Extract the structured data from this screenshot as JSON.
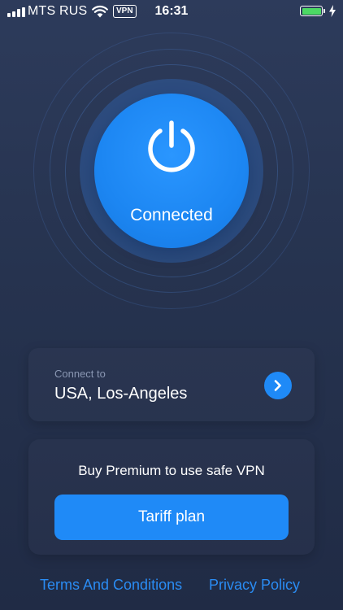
{
  "status_bar": {
    "carrier": "MTS RUS",
    "vpn_badge": "VPN",
    "time": "16:31",
    "battery_color": "#4cd964",
    "icons": [
      "signal-icon",
      "wifi-icon",
      "battery-icon",
      "charging-bolt-icon"
    ]
  },
  "power": {
    "status": "Connected",
    "icon": "power-icon",
    "accent_color": "#1f8af7"
  },
  "connect": {
    "caption": "Connect to",
    "location": "USA, Los-Angeles",
    "icon": "chevron-right-icon"
  },
  "premium": {
    "message": "Buy Premium to use safe VPN",
    "button_label": "Tariff plan"
  },
  "footer": {
    "terms_label": "Terms And Conditions",
    "privacy_label": "Privacy Policy",
    "link_color": "#2a8cf3"
  }
}
